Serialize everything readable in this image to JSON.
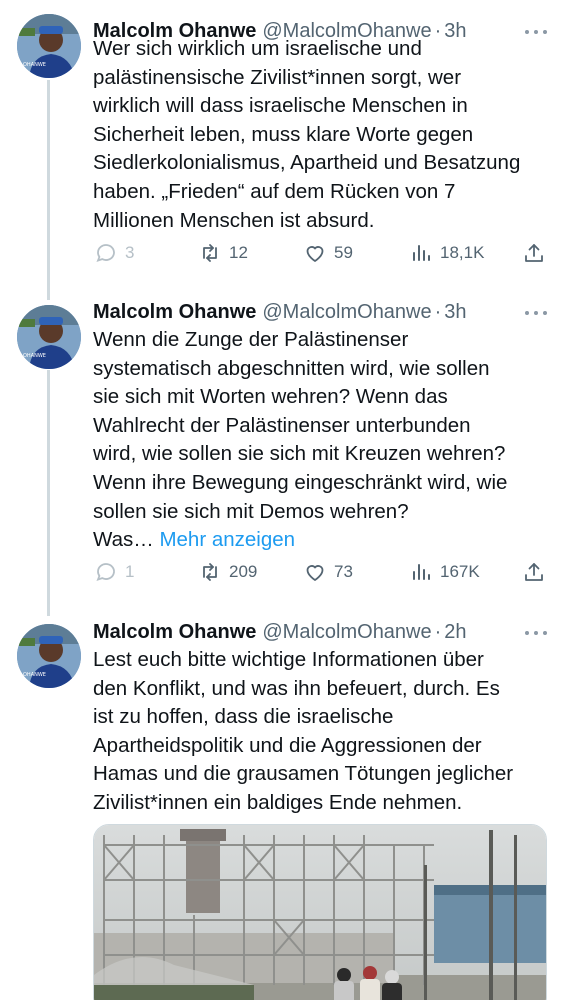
{
  "colors": {
    "text": "#0f1419",
    "secondary": "#536471",
    "link": "#1d9bf0",
    "thread_line": "#cfd9de"
  },
  "icons": {
    "reply": "reply-icon",
    "retweet": "retweet-icon",
    "like": "heart-icon",
    "views": "views-icon",
    "share": "share-icon",
    "more": "more-dots-icon"
  },
  "tweets": [
    {
      "name": "Malcolm Ohanwe",
      "handle": "@MalcolmOhanwe",
      "separator": "·",
      "time": "3h",
      "lines": [
        "Wer sich wirklich um israelische und",
        "palästinensische Zivilist*innen sorgt, wer",
        "wirklich will dass israelische Menschen in",
        "Sicherheit leben, muss klare Worte gegen",
        "Siedlerkolonialismus, Apartheid und Besatzung",
        "haben. „Frieden“ auf dem Rücken von 7",
        "Millionen Menschen ist absurd."
      ],
      "replies": "3",
      "retweets": "12",
      "likes": "59",
      "views": "18,1K"
    },
    {
      "name": "Malcolm Ohanwe",
      "handle": "@MalcolmOhanwe",
      "separator": "·",
      "time": "3h",
      "lines": [
        "Wenn die Zunge der Palästinenser",
        "systematisch abgeschnitten wird, wie sollen",
        "sie sich mit Worten wehren? Wenn das",
        "Wahlrecht der Palästinenser unterbunden",
        "wird, wie sollen sie sich mit Kreuzen wehren?",
        "Wenn ihre Bewegung eingeschränkt wird, wie",
        "sollen sie sich mit Demos wehren?"
      ],
      "truncated_text": "Was…",
      "show_more": "Mehr anzeigen",
      "replies": "1",
      "retweets": "209",
      "likes": "73",
      "views": "167K"
    },
    {
      "name": "Malcolm Ohanwe",
      "handle": "@MalcolmOhanwe",
      "separator": "·",
      "time": "2h",
      "lines": [
        "Lest euch bitte wichtige Informationen über",
        "den Konflikt, und was ihn befeuert, durch. Es",
        "ist zu hoffen, dass die israelische",
        "Apartheidspolitik und die Aggressionen der",
        "Hamas und die grausamen Tötungen jeglicher",
        "Zivilist*innen ein baldiges Ende nehmen."
      ]
    }
  ]
}
